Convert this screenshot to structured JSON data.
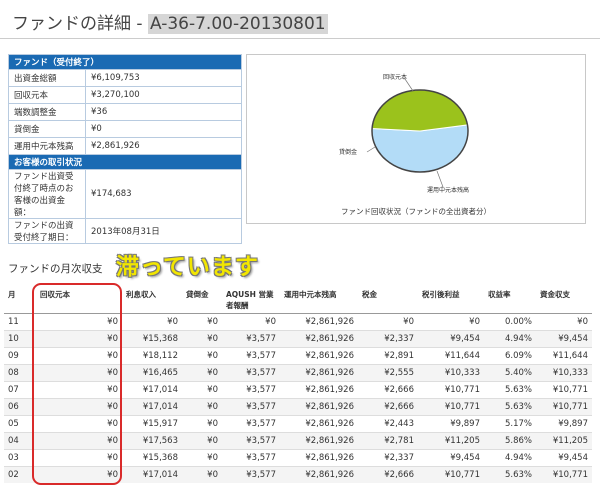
{
  "page": {
    "title_prefix": "ファンドの詳細 - ",
    "fund_id": "A-36-7.00-20130801"
  },
  "fund_info": {
    "header": "ファンド（受付終了）",
    "rows": [
      {
        "label": "出資金総額",
        "value": "¥6,109,753"
      },
      {
        "label": "回収元本",
        "value": "¥3,270,100"
      },
      {
        "label": "端数調整金",
        "value": "¥36"
      },
      {
        "label": "貸倒金",
        "value": "¥0"
      },
      {
        "label": "運用中元本残高",
        "value": "¥2,861,926"
      }
    ],
    "customer_header": "お客様の取引状況",
    "customer_rows": [
      {
        "label": "ファンド出資受付終了時点のお客様の出資金額：",
        "value": "¥174,683"
      },
      {
        "label": "ファンドの出資受付終了期日：",
        "value": "2013年08月31日"
      }
    ]
  },
  "chart_data": {
    "type": "pie",
    "caption": "ファンド回収状況（ファンドの全出資者分）",
    "labels": [
      "回収元本",
      "貸倒金",
      "運用中元本残高"
    ],
    "values": [
      3270100,
      0,
      2861926
    ],
    "colors": [
      "#b3dcf7",
      "#7f7f7f",
      "#9bc21c"
    ]
  },
  "monthly": {
    "section_title": "ファンドの月次収支",
    "note": "滞っています",
    "headers": [
      "月",
      "回収元本",
      "利息収入",
      "貸倒金",
      "AQUSH 営業者報酬",
      "運用中元本残高",
      "税金",
      "税引後利益",
      "収益率",
      "資金収支"
    ],
    "rows": [
      [
        "11",
        "¥0",
        "¥0",
        "¥0",
        "¥0",
        "¥2,861,926",
        "¥0",
        "¥0",
        "0.00%",
        "¥0"
      ],
      [
        "10",
        "¥0",
        "¥15,368",
        "¥0",
        "¥3,577",
        "¥2,861,926",
        "¥2,337",
        "¥9,454",
        "4.94%",
        "¥9,454"
      ],
      [
        "09",
        "¥0",
        "¥18,112",
        "¥0",
        "¥3,577",
        "¥2,861,926",
        "¥2,891",
        "¥11,644",
        "6.09%",
        "¥11,644"
      ],
      [
        "08",
        "¥0",
        "¥16,465",
        "¥0",
        "¥3,577",
        "¥2,861,926",
        "¥2,555",
        "¥10,333",
        "5.40%",
        "¥10,333"
      ],
      [
        "07",
        "¥0",
        "¥17,014",
        "¥0",
        "¥3,577",
        "¥2,861,926",
        "¥2,666",
        "¥10,771",
        "5.63%",
        "¥10,771"
      ],
      [
        "06",
        "¥0",
        "¥17,014",
        "¥0",
        "¥3,577",
        "¥2,861,926",
        "¥2,666",
        "¥10,771",
        "5.63%",
        "¥10,771"
      ],
      [
        "05",
        "¥0",
        "¥15,917",
        "¥0",
        "¥3,577",
        "¥2,861,926",
        "¥2,443",
        "¥9,897",
        "5.17%",
        "¥9,897"
      ],
      [
        "04",
        "¥0",
        "¥17,563",
        "¥0",
        "¥3,577",
        "¥2,861,926",
        "¥2,781",
        "¥11,205",
        "5.86%",
        "¥11,205"
      ],
      [
        "03",
        "¥0",
        "¥15,368",
        "¥0",
        "¥3,577",
        "¥2,861,926",
        "¥2,337",
        "¥9,454",
        "4.94%",
        "¥9,454"
      ],
      [
        "02",
        "¥0",
        "¥17,014",
        "¥0",
        "¥3,577",
        "¥2,861,926",
        "¥2,666",
        "¥10,771",
        "5.63%",
        "¥10,771"
      ]
    ]
  }
}
